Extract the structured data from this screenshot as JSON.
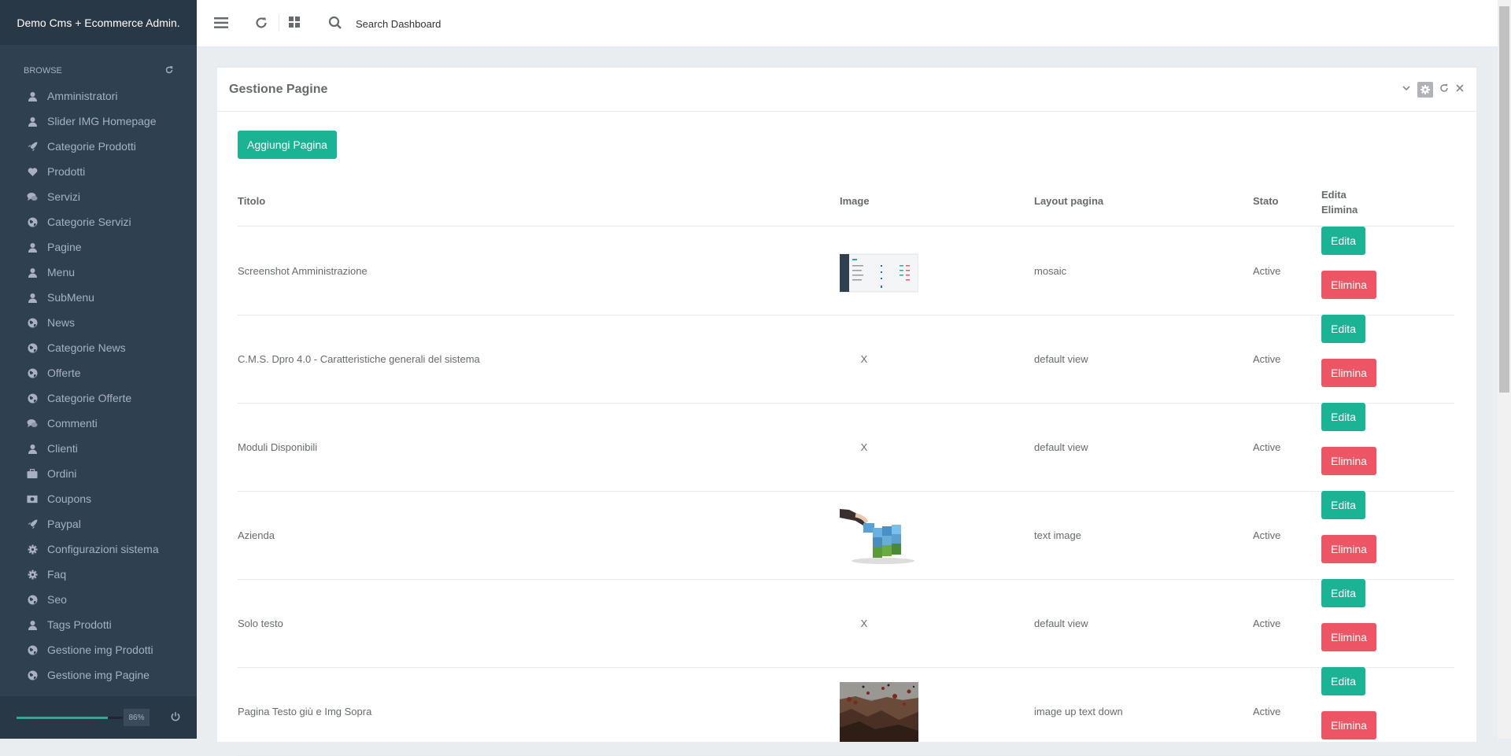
{
  "app": {
    "brand": "Demo Cms + Ecommerce Admin."
  },
  "sidebar": {
    "section_label": "BROWSE",
    "items": [
      {
        "label": "Amministratori",
        "icon": "user-icon"
      },
      {
        "label": "Slider IMG Homepage",
        "icon": "user-icon"
      },
      {
        "label": "Categorie Prodotti",
        "icon": "rocket-icon"
      },
      {
        "label": "Prodotti",
        "icon": "heart-icon"
      },
      {
        "label": "Servizi",
        "icon": "comments-icon"
      },
      {
        "label": "Categorie Servizi",
        "icon": "globe-icon"
      },
      {
        "label": "Pagine",
        "icon": "user-icon"
      },
      {
        "label": "Menu",
        "icon": "user-icon"
      },
      {
        "label": "SubMenu",
        "icon": "user-icon"
      },
      {
        "label": "News",
        "icon": "globe-icon"
      },
      {
        "label": "Categorie News",
        "icon": "globe-icon"
      },
      {
        "label": "Offerte",
        "icon": "globe-icon"
      },
      {
        "label": "Categorie Offerte",
        "icon": "globe-icon"
      },
      {
        "label": "Commenti",
        "icon": "comments-icon"
      },
      {
        "label": "Clienti",
        "icon": "user-icon"
      },
      {
        "label": "Ordini",
        "icon": "briefcase-icon"
      },
      {
        "label": "Coupons",
        "icon": "money-icon"
      },
      {
        "label": "Paypal",
        "icon": "rocket-icon"
      },
      {
        "label": "Configurazioni sistema",
        "icon": "gear-icon"
      },
      {
        "label": "Faq",
        "icon": "gear-icon"
      },
      {
        "label": "Seo",
        "icon": "globe-icon"
      },
      {
        "label": "Tags Prodotti",
        "icon": "user-icon"
      },
      {
        "label": "Gestione img Prodotti",
        "icon": "globe-icon"
      },
      {
        "label": "Gestione img Pagine",
        "icon": "globe-icon"
      }
    ],
    "progress_percent": 86,
    "progress_label": "86%"
  },
  "topbar": {
    "search_placeholder": "Search Dashboard"
  },
  "panel": {
    "title": "Gestione Pagine",
    "add_button": "Aggiungi Pagina",
    "columns": {
      "title": "Titolo",
      "image": "Image",
      "layout": "Layout pagina",
      "status": "Stato",
      "actions_line1": "Edita",
      "actions_line2": "Elimina"
    },
    "edit_label": "Edita",
    "delete_label": "Elimina",
    "rows": [
      {
        "title": "Screenshot Amministrazione",
        "image": "screenshot",
        "image_text": "",
        "layout": "mosaic",
        "status": "Active"
      },
      {
        "title": "C.M.S. Dpro 4.0 - Caratteristiche generali del sistema",
        "image": "none",
        "image_text": "X",
        "layout": "default view",
        "status": "Active"
      },
      {
        "title": "Moduli Disponibili",
        "image": "none",
        "image_text": "X",
        "layout": "default view",
        "status": "Active"
      },
      {
        "title": "Azienda",
        "image": "cubes",
        "image_text": "",
        "layout": "text image",
        "status": "Active"
      },
      {
        "title": "Solo testo",
        "image": "none",
        "image_text": "X",
        "layout": "default view",
        "status": "Active"
      },
      {
        "title": "Pagina Testo giù e Img Sopra",
        "image": "balloons",
        "image_text": "",
        "layout": "image up text down",
        "status": "Active"
      }
    ]
  },
  "colors": {
    "sidebar_bg": "#2f4050",
    "primary": "#1ab394",
    "danger": "#ed5565"
  }
}
